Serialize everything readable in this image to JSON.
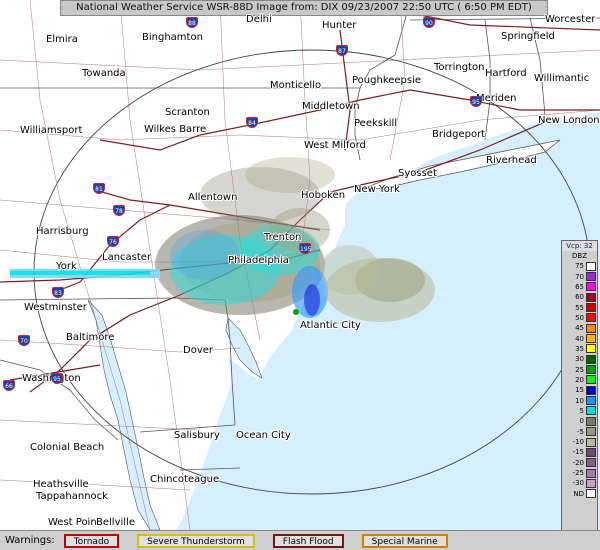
{
  "header": {
    "title": "National Weather Service WSR-88D Image  from: DIX 09/23/2007 22:50 UTC ( 6:50 PM EDT)"
  },
  "colors": {
    "land": "#ffffff",
    "water": "#d6efff",
    "highway": "#7a1f1f",
    "roads": "#a05050",
    "borders": "#555555"
  },
  "cities": [
    {
      "id": "worcester",
      "label": "Worcester"
    },
    {
      "id": "elmira",
      "label": "Elmira"
    },
    {
      "id": "binghamton",
      "label": "Binghamton"
    },
    {
      "id": "delhi",
      "label": "Delhi"
    },
    {
      "id": "hunter",
      "label": "Hunter"
    },
    {
      "id": "springfield",
      "label": "Springfield"
    },
    {
      "id": "towanda",
      "label": "Towanda"
    },
    {
      "id": "monticello",
      "label": "Monticello"
    },
    {
      "id": "poughkeepsie",
      "label": "Poughkeepsie"
    },
    {
      "id": "torrington",
      "label": "Torrington"
    },
    {
      "id": "hartford",
      "label": "Hartford"
    },
    {
      "id": "willimantic",
      "label": "Willimantic"
    },
    {
      "id": "middletown",
      "label": "Middletown"
    },
    {
      "id": "meriden",
      "label": "Meriden"
    },
    {
      "id": "scranton",
      "label": "Scranton"
    },
    {
      "id": "wilkesbarre",
      "label": "Wilkes Barre"
    },
    {
      "id": "peekskill",
      "label": "Peekskill"
    },
    {
      "id": "newlondon",
      "label": "New London"
    },
    {
      "id": "williamsport",
      "label": "Williamsport"
    },
    {
      "id": "bridgeport",
      "label": "Bridgeport"
    },
    {
      "id": "westmilford",
      "label": "West Milford"
    },
    {
      "id": "riverhead",
      "label": "Riverhead"
    },
    {
      "id": "syosset",
      "label": "Syosset"
    },
    {
      "id": "newyork",
      "label": "New York"
    },
    {
      "id": "hoboken",
      "label": "Hoboken"
    },
    {
      "id": "allentown",
      "label": "Allentown"
    },
    {
      "id": "harrisburg",
      "label": "Harrisburg"
    },
    {
      "id": "trenton",
      "label": "Trenton"
    },
    {
      "id": "lancaster",
      "label": "Lancaster"
    },
    {
      "id": "philadelphia",
      "label": "Philadelphia"
    },
    {
      "id": "york",
      "label": "York"
    },
    {
      "id": "westminster",
      "label": "Westminster"
    },
    {
      "id": "atlanticcity",
      "label": "Atlantic City"
    },
    {
      "id": "baltimore",
      "label": "Baltimore"
    },
    {
      "id": "dover",
      "label": "Dover"
    },
    {
      "id": "washington",
      "label": "Washington"
    },
    {
      "id": "salisbury",
      "label": "Salisbury"
    },
    {
      "id": "oceancity",
      "label": "Ocean City"
    },
    {
      "id": "colonialbeach",
      "label": "Colonial Beach"
    },
    {
      "id": "chincoteague",
      "label": "Chincoteague"
    },
    {
      "id": "heathsville",
      "label": "Heathsville"
    },
    {
      "id": "tappahannock",
      "label": "Tappahannock"
    },
    {
      "id": "westpoint",
      "label": "West Point"
    },
    {
      "id": "bellville",
      "label": "Bellville"
    }
  ],
  "highway_shields": [
    {
      "id": "i88",
      "label": "88"
    },
    {
      "id": "i87",
      "label": "87"
    },
    {
      "id": "i90",
      "label": "90"
    },
    {
      "id": "i84",
      "label": "84"
    },
    {
      "id": "i95n",
      "label": "95"
    },
    {
      "id": "i81",
      "label": "81"
    },
    {
      "id": "i78",
      "label": "78"
    },
    {
      "id": "i76",
      "label": "76"
    },
    {
      "id": "i195",
      "label": "195"
    },
    {
      "id": "i83",
      "label": "83"
    },
    {
      "id": "i70",
      "label": "70"
    },
    {
      "id": "i66",
      "label": "66"
    },
    {
      "id": "i95s",
      "label": "95"
    }
  ],
  "legend": {
    "title": "Vcp: 32",
    "unit": "DBZ",
    "entries": [
      {
        "label": "75",
        "color": "#ffffff"
      },
      {
        "label": "70",
        "color": "#9c27d8"
      },
      {
        "label": "65",
        "color": "#ff00ff"
      },
      {
        "label": "60",
        "color": "#a0002a"
      },
      {
        "label": "55",
        "color": "#c80000"
      },
      {
        "label": "50",
        "color": "#ff0000"
      },
      {
        "label": "45",
        "color": "#ff8c00"
      },
      {
        "label": "40",
        "color": "#ffb400"
      },
      {
        "label": "35",
        "color": "#ffff00"
      },
      {
        "label": "30",
        "color": "#006400"
      },
      {
        "label": "25",
        "color": "#00a000"
      },
      {
        "label": "20",
        "color": "#00ff00"
      },
      {
        "label": "15",
        "color": "#0000c8"
      },
      {
        "label": "10",
        "color": "#1e90ff"
      },
      {
        "label": "5",
        "color": "#00e0e0"
      },
      {
        "label": "0",
        "color": "#7a7a6a"
      },
      {
        "label": "-5",
        "color": "#9a9a7a"
      },
      {
        "label": "-10",
        "color": "#b8b890"
      },
      {
        "label": "-15",
        "color": "#6e4a6e"
      },
      {
        "label": "-20",
        "color": "#8a5a8a"
      },
      {
        "label": "-25",
        "color": "#aa78aa"
      },
      {
        "label": "-30",
        "color": "#c8a0c8"
      },
      {
        "label": "ND",
        "color": "#ffffff"
      }
    ]
  },
  "warnings": {
    "label": "Warnings:",
    "items": [
      {
        "label": "Tornado",
        "color": "#c00000"
      },
      {
        "label": "Severe Thunderstorm",
        "color": "#d4c000"
      },
      {
        "label": "Flash Flood",
        "color": "#7a1414"
      },
      {
        "label": "Special Marine",
        "color": "#d08000"
      }
    ]
  }
}
